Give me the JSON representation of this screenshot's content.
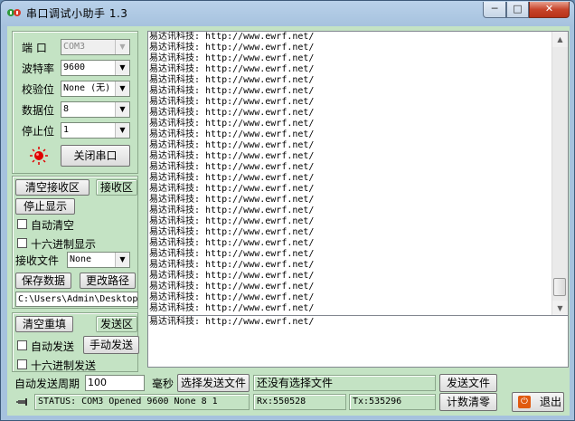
{
  "window": {
    "title": "串口调试小助手 1.3",
    "min": "─",
    "max": "□",
    "close": "✕"
  },
  "serial": {
    "port_label": "端  口",
    "port_value": "COM3",
    "baud_label": "波特率",
    "baud_value": "9600",
    "parity_label": "校验位",
    "parity_value": "None (无)",
    "databits_label": "数据位",
    "databits_value": "8",
    "stopbits_label": "停止位",
    "stopbits_value": "1",
    "open_button": "关闭串口",
    "led_color": "#e00000"
  },
  "receive": {
    "clear_button": "清空接收区",
    "area_button": "接收区",
    "stop_button": "停止显示",
    "auto_clear_label": "自动清空",
    "hex_display_label": "十六进制显示",
    "file_label": "接收文件",
    "file_value": "None",
    "save_button": "保存数据",
    "change_path_button": "更改路径",
    "path_value": "C:\\Users\\Admin\\Desktop",
    "lines": [
      "易达讯科技: http://www.ewrf.net/",
      "易达讯科技: http://www.ewrf.net/",
      "易达讯科技: http://www.ewrf.net/",
      "易达讯科技: http://www.ewrf.net/",
      "易达讯科技: http://www.ewrf.net/",
      "易达讯科技: http://www.ewrf.net/",
      "易达讯科技: http://www.ewrf.net/",
      "易达讯科技: http://www.ewrf.net/",
      "易达讯科技: http://www.ewrf.net/",
      "易达讯科技: http://www.ewrf.net/",
      "易达讯科技: http://www.ewrf.net/",
      "易达讯科技: http://www.ewrf.net/",
      "易达讯科技: http://www.ewrf.net/",
      "易达讯科技: http://www.ewrf.net/",
      "易达讯科技: http://www.ewrf.net/",
      "易达讯科技: http://www.ewrf.net/",
      "易达讯科技: http://www.ewrf.net/",
      "易达讯科技: http://www.ewrf.net/",
      "易达讯科技: http://www.ewrf.net/",
      "易达讯科技: http://www.ewrf.net/",
      "易达讯科技: http://www.ewrf.net/",
      "易达讯科技: http://www.ewrf.net/",
      "易达讯科技: http://www.ewrf.net/",
      "易达讯科技: http://www.ewrf.net/",
      "易达讯科技: http://www.ewrf.net/",
      "易达讯科技: http://www.ewrf.net/"
    ]
  },
  "send": {
    "clear_button": "清空重填",
    "area_button": "发送区",
    "auto_send_label": "自动发送",
    "manual_button": "手动发送",
    "hex_send_label": "十六进制发送",
    "content": "易达讯科技: http://www.ewrf.net/",
    "period_label": "自动发送周期",
    "period_value": "100",
    "period_unit": "毫秒",
    "choose_file_button": "选择发送文件",
    "file_status": "还没有选择文件",
    "send_file_button": "发送文件",
    "reset_count_button": "计数清零",
    "exit_button": "退出"
  },
  "status": {
    "text": "STATUS: COM3 Opened 9600 None  8 1",
    "rx": "Rx:550528",
    "tx": "Tx:535296"
  }
}
